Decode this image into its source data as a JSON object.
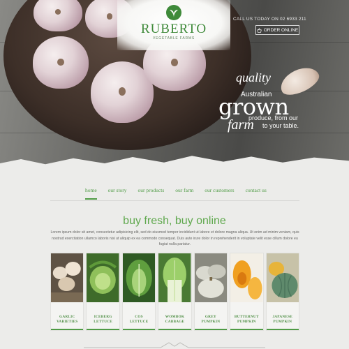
{
  "brand": {
    "name": "RUBERTO",
    "tagline": "VEGETABLE FARMS",
    "color": "#3f8a3a"
  },
  "header": {
    "call_text": "CALL US TODAY ON 02 6933 211",
    "order_label": "ORDER ONLINE",
    "order_icon": "basket-icon"
  },
  "hero": {
    "quality": "quality",
    "australian": "Australian",
    "grown": "grown",
    "produce": "produce, from our",
    "farm": "farm",
    "table": "to your table."
  },
  "nav": {
    "items": [
      {
        "label": "home",
        "active": true
      },
      {
        "label": "our story",
        "active": false
      },
      {
        "label": "our products",
        "active": false
      },
      {
        "label": "our farm",
        "active": false
      },
      {
        "label": "our customers",
        "active": false
      },
      {
        "label": "contact us",
        "active": false
      }
    ]
  },
  "main": {
    "heading": "buy fresh, buy online",
    "intro": "Lorem ipsum dolor sit amet, consectetur adipisicing elit, sed do eiusmod tempor incididunt ut labore et dolore magna aliqua. Ut enim ad minim veniam, quis nostrud exercitation ullamco laboris nisi ut aliquip ex ea commodo consequat. Duis aute irure dolor in reprehenderit in voluptate velit esse cillum dolore eu fugiat nulla pariatur."
  },
  "products": [
    {
      "line1": "GARLIC",
      "line2": "VARIETIES",
      "color": "#8b7d66"
    },
    {
      "line1": "ICEBERG",
      "line2": "LETTUCE",
      "color": "#6fa14a"
    },
    {
      "line1": "COS",
      "line2": "LETTUCE",
      "color": "#4c8a3a"
    },
    {
      "line1": "WOMBOK",
      "line2": "CABBAGE",
      "color": "#8fbf6a"
    },
    {
      "line1": "GREY",
      "line2": "PUMPKIN",
      "color": "#bcbcb0"
    },
    {
      "line1": "BUTTERNUT",
      "line2": "PUMPKIN",
      "color": "#e89a2a"
    },
    {
      "line1": "JAPANESE",
      "line2": "PUMPKIN",
      "color": "#5f8a6c"
    }
  ],
  "colors": {
    "accent": "#4f9b45",
    "heading": "#5fa84d",
    "page_bg": "#ececea"
  }
}
